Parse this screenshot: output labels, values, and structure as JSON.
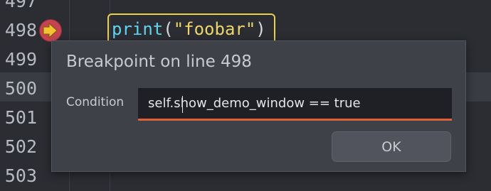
{
  "editor": {
    "line_numbers": [
      "497",
      "498",
      "499",
      "500",
      "501",
      "502",
      "503"
    ],
    "current_line": "500",
    "code": {
      "function": "print",
      "open_paren": "(",
      "string": "\"foobar\"",
      "close_paren": ")"
    },
    "breakpoint_icon": "breakpoint-arrow-icon"
  },
  "dialog": {
    "title": "Breakpoint on line 498",
    "condition_label": "Condition",
    "condition_value": "self.show_demo_window == true",
    "ok_label": "OK"
  },
  "colors": {
    "background": "#2b2d33",
    "current_line": "#3a3c44",
    "function": "#63d3ec",
    "string": "#ecd56a",
    "highlight_border": "#e8d24a",
    "breakpoint": "#c64451",
    "input_underline": "#e0603a"
  }
}
